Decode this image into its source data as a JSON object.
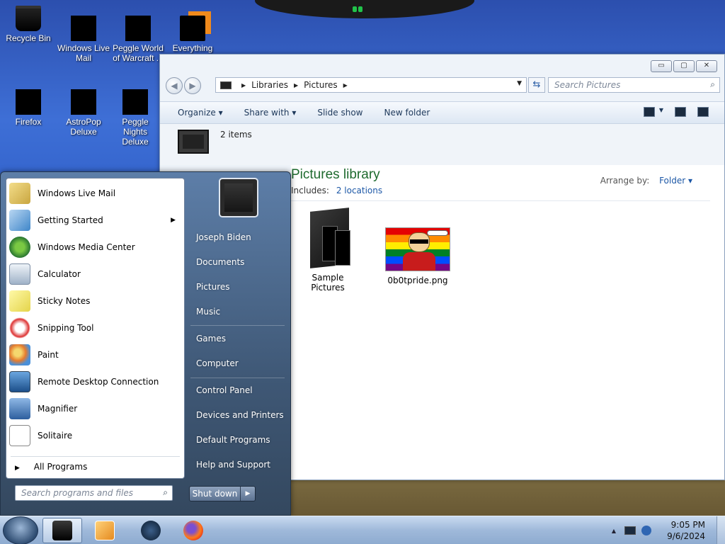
{
  "desktop": {
    "icons": [
      {
        "label": "Recycle Bin"
      },
      {
        "label": "Windows Live Mail"
      },
      {
        "label": "Peggle World of Warcraft ..."
      },
      {
        "label": "Everything"
      },
      {
        "label": "Firefox"
      },
      {
        "label": "AstroPop Deluxe"
      },
      {
        "label": "Peggle Nights Deluxe"
      }
    ]
  },
  "explorer": {
    "breadcrumb": [
      "Libraries",
      "Pictures"
    ],
    "search_placeholder": "Search Pictures",
    "toolbar": {
      "organize": "Organize",
      "share_with": "Share with",
      "slide_show": "Slide show",
      "new_folder": "New folder"
    },
    "item_count": "2 items",
    "library_title": "Pictures library",
    "includes_label": "Includes:",
    "includes_link": "2 locations",
    "arrange_label": "Arrange by:",
    "arrange_value": "Folder",
    "items": [
      {
        "name": "Sample Pictures"
      },
      {
        "name": "0b0tpride.png"
      }
    ],
    "window_controls": {
      "minimize": "▭",
      "maximize": "▢",
      "close": "✕"
    }
  },
  "start_menu": {
    "programs": [
      {
        "label": "Windows Live Mail",
        "icon": "mail-icon"
      },
      {
        "label": "Getting Started",
        "icon": "getting-started-icon",
        "submenu": true
      },
      {
        "label": "Windows Media Center",
        "icon": "media-center-icon"
      },
      {
        "label": "Calculator",
        "icon": "calculator-icon"
      },
      {
        "label": "Sticky Notes",
        "icon": "sticky-notes-icon"
      },
      {
        "label": "Snipping Tool",
        "icon": "snipping-tool-icon"
      },
      {
        "label": "Paint",
        "icon": "paint-icon"
      },
      {
        "label": "Remote Desktop Connection",
        "icon": "remote-desktop-icon"
      },
      {
        "label": "Magnifier",
        "icon": "magnifier-icon"
      },
      {
        "label": "Solitaire",
        "icon": "solitaire-icon"
      }
    ],
    "all_programs": "All Programs",
    "search_placeholder": "Search programs and files",
    "right_links": [
      "Joseph Biden",
      "Documents",
      "Pictures",
      "Music",
      "Games",
      "Computer",
      "Control Panel",
      "Devices and Printers",
      "Default Programs",
      "Help and Support"
    ],
    "shutdown": "Shut down"
  },
  "taskbar": {
    "time": "9:05 PM",
    "date": "9/6/2024"
  },
  "colors": {
    "library_title": "#1e6a2e",
    "link": "#1c57a6"
  }
}
